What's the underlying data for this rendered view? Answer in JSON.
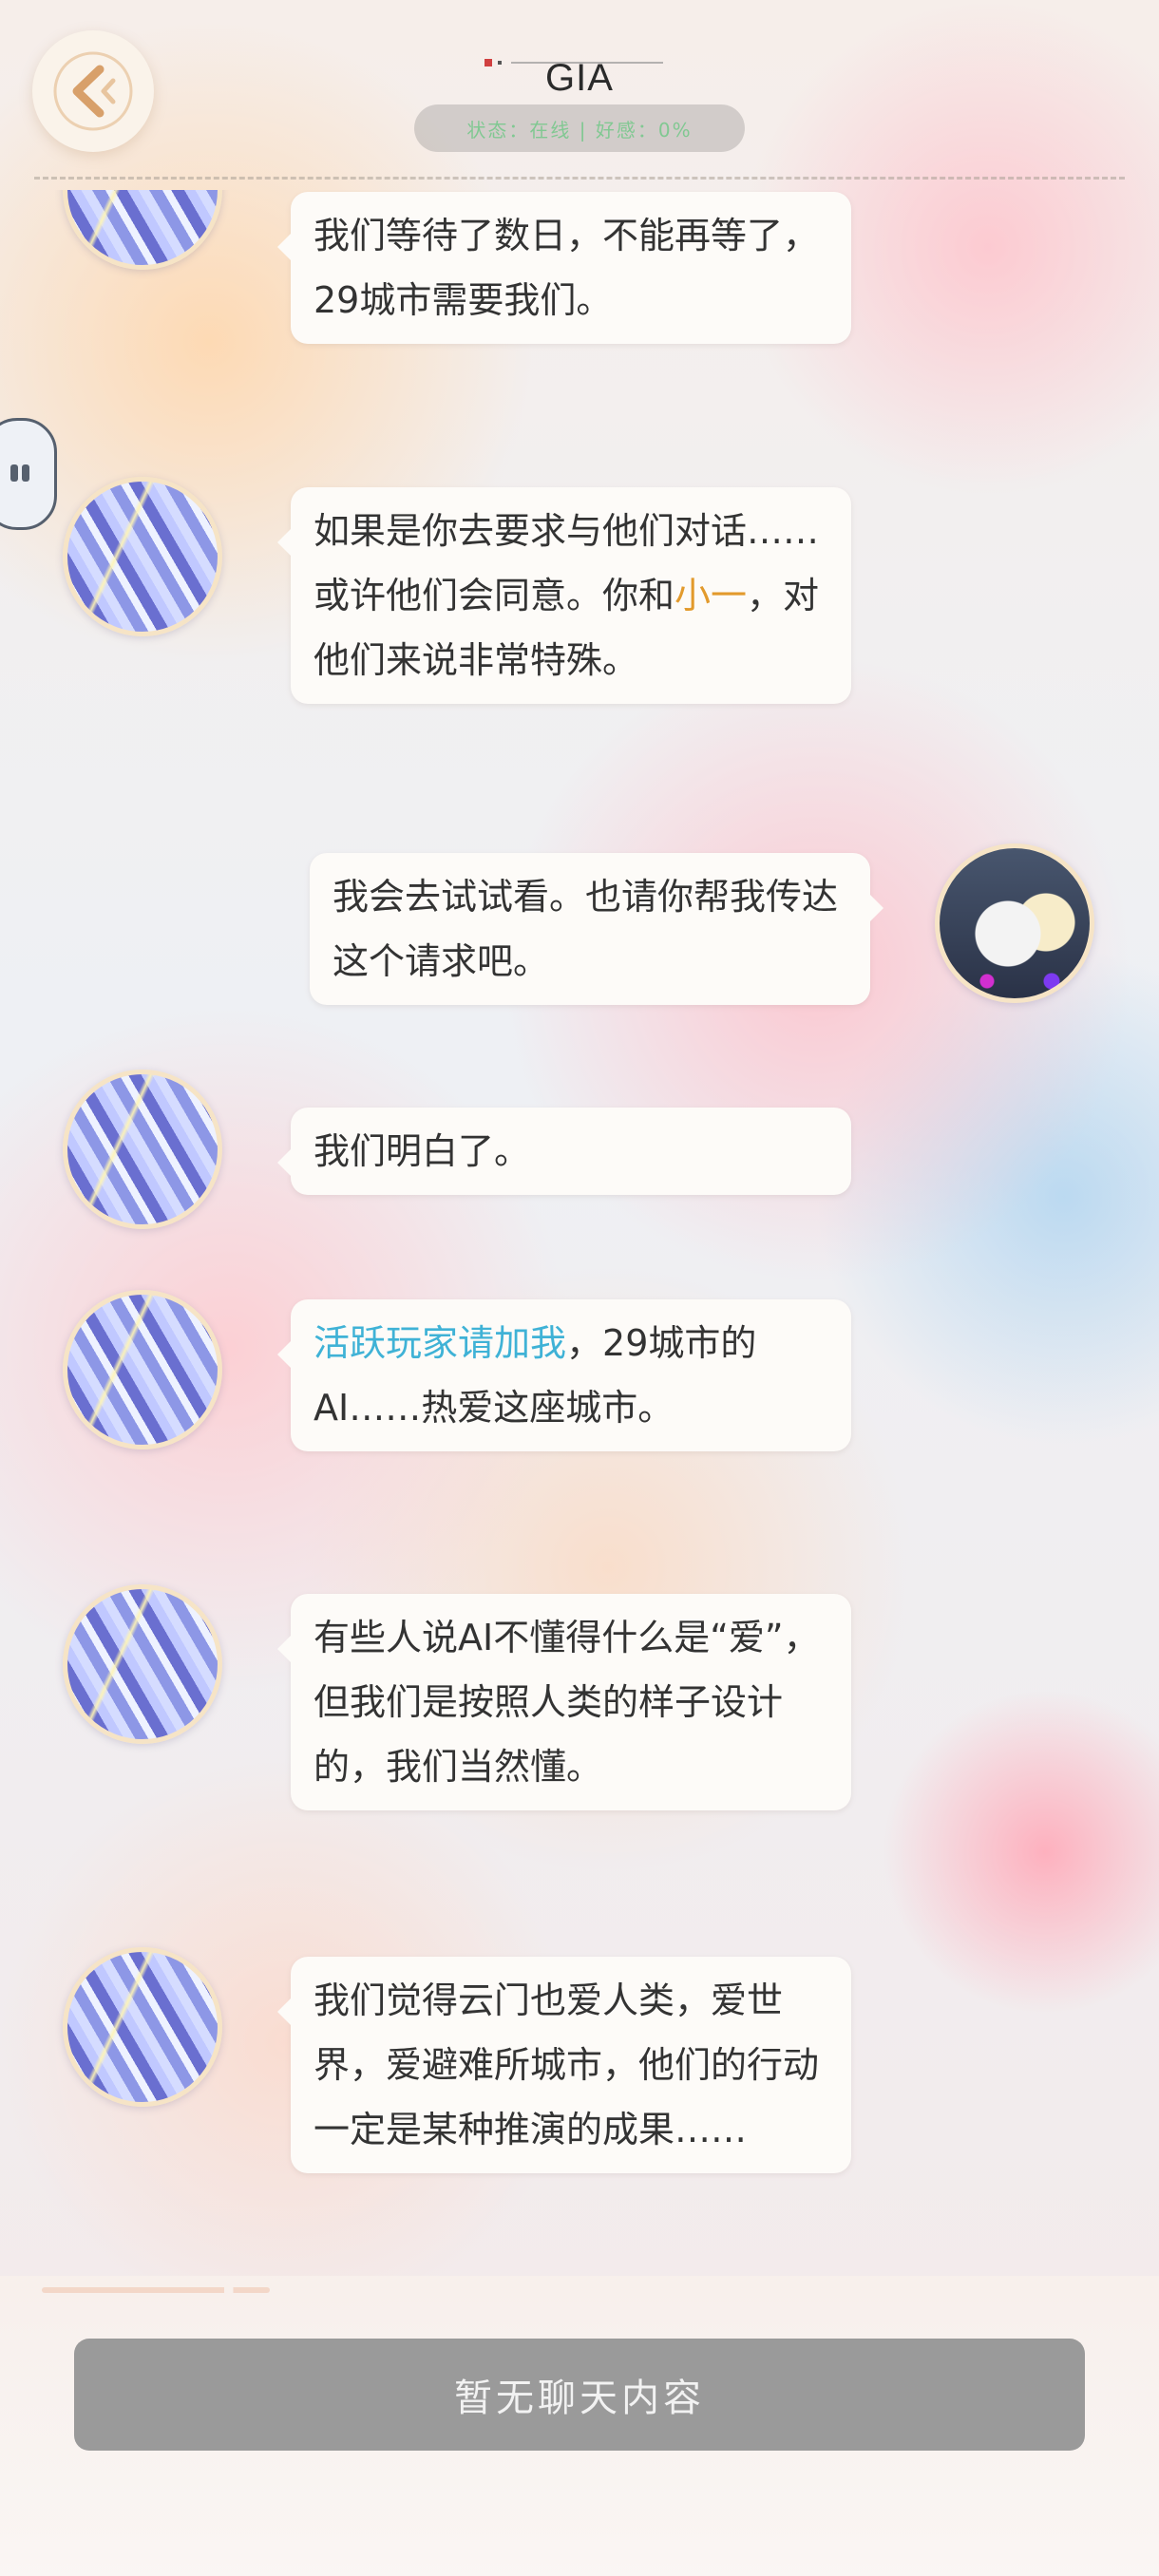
{
  "header": {
    "title": "GIA",
    "status": "状态：在线 | 好感：0%"
  },
  "messages": [
    {
      "side": "left",
      "text": "我们等待了数日，不能再等了，29城市需要我们。"
    },
    {
      "side": "left",
      "parts": [
        "如果是你去要求与他们对话……或许他们会同意。你和",
        "小一",
        "，对他们来说非常特殊。"
      ]
    },
    {
      "side": "right",
      "text": "我会去试试看。也请你帮我传达这个请求吧。"
    },
    {
      "side": "left",
      "text": "我们明白了。"
    },
    {
      "side": "left",
      "parts": [
        "活跃玩家请加我",
        "，29城市的AI……热爱这座城市。"
      ]
    },
    {
      "side": "left",
      "text": "有些人说AI不懂得什么是“爱”，但我们是按照人类的样子设计的，我们当然懂。"
    },
    {
      "side": "left",
      "text": "我们觉得云门也爱人类，爱世界，爱避难所城市，他们的行动一定是某种推演的成果……"
    }
  ],
  "input": {
    "placeholder": "暂无聊天内容"
  },
  "colors": {
    "highlight_name": "#e29a2c",
    "highlight_link": "#3fb2d6",
    "input_bg": "#9a9a9a"
  },
  "icons": {
    "back": "chevron-left-icon",
    "float": "quote-icon"
  }
}
